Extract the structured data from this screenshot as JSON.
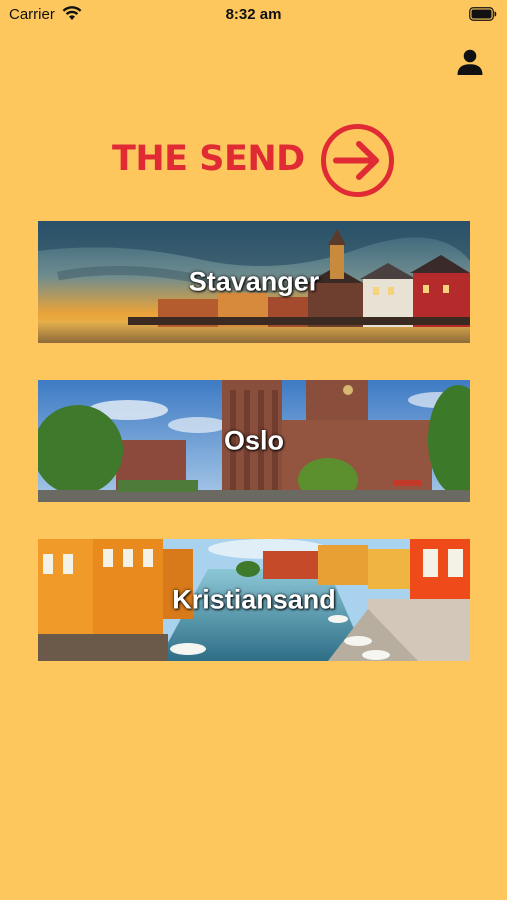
{
  "status_bar": {
    "carrier": "Carrier",
    "time": "8:32 am"
  },
  "header": {
    "profile_icon": "person-icon"
  },
  "logo": {
    "text": "THE SEND",
    "icon": "arrow-circle-right-icon",
    "color": "#E02B35"
  },
  "theme": {
    "background": "#FDC75E",
    "accent": "#E02B35"
  },
  "cities": [
    {
      "label": "Stavanger"
    },
    {
      "label": "Oslo"
    },
    {
      "label": "Kristiansand"
    }
  ]
}
